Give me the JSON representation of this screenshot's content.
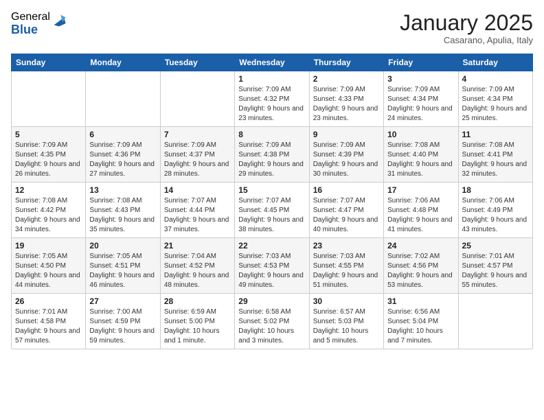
{
  "logo": {
    "general": "General",
    "blue": "Blue"
  },
  "header": {
    "month": "January 2025",
    "location": "Casarano, Apulia, Italy"
  },
  "weekdays": [
    "Sunday",
    "Monday",
    "Tuesday",
    "Wednesday",
    "Thursday",
    "Friday",
    "Saturday"
  ],
  "weeks": [
    [
      {
        "day": "",
        "sunrise": "",
        "sunset": "",
        "daylight": ""
      },
      {
        "day": "",
        "sunrise": "",
        "sunset": "",
        "daylight": ""
      },
      {
        "day": "",
        "sunrise": "",
        "sunset": "",
        "daylight": ""
      },
      {
        "day": "1",
        "sunrise": "Sunrise: 7:09 AM",
        "sunset": "Sunset: 4:32 PM",
        "daylight": "Daylight: 9 hours and 23 minutes."
      },
      {
        "day": "2",
        "sunrise": "Sunrise: 7:09 AM",
        "sunset": "Sunset: 4:33 PM",
        "daylight": "Daylight: 9 hours and 23 minutes."
      },
      {
        "day": "3",
        "sunrise": "Sunrise: 7:09 AM",
        "sunset": "Sunset: 4:34 PM",
        "daylight": "Daylight: 9 hours and 24 minutes."
      },
      {
        "day": "4",
        "sunrise": "Sunrise: 7:09 AM",
        "sunset": "Sunset: 4:34 PM",
        "daylight": "Daylight: 9 hours and 25 minutes."
      }
    ],
    [
      {
        "day": "5",
        "sunrise": "Sunrise: 7:09 AM",
        "sunset": "Sunset: 4:35 PM",
        "daylight": "Daylight: 9 hours and 26 minutes."
      },
      {
        "day": "6",
        "sunrise": "Sunrise: 7:09 AM",
        "sunset": "Sunset: 4:36 PM",
        "daylight": "Daylight: 9 hours and 27 minutes."
      },
      {
        "day": "7",
        "sunrise": "Sunrise: 7:09 AM",
        "sunset": "Sunset: 4:37 PM",
        "daylight": "Daylight: 9 hours and 28 minutes."
      },
      {
        "day": "8",
        "sunrise": "Sunrise: 7:09 AM",
        "sunset": "Sunset: 4:38 PM",
        "daylight": "Daylight: 9 hours and 29 minutes."
      },
      {
        "day": "9",
        "sunrise": "Sunrise: 7:09 AM",
        "sunset": "Sunset: 4:39 PM",
        "daylight": "Daylight: 9 hours and 30 minutes."
      },
      {
        "day": "10",
        "sunrise": "Sunrise: 7:08 AM",
        "sunset": "Sunset: 4:40 PM",
        "daylight": "Daylight: 9 hours and 31 minutes."
      },
      {
        "day": "11",
        "sunrise": "Sunrise: 7:08 AM",
        "sunset": "Sunset: 4:41 PM",
        "daylight": "Daylight: 9 hours and 32 minutes."
      }
    ],
    [
      {
        "day": "12",
        "sunrise": "Sunrise: 7:08 AM",
        "sunset": "Sunset: 4:42 PM",
        "daylight": "Daylight: 9 hours and 34 minutes."
      },
      {
        "day": "13",
        "sunrise": "Sunrise: 7:08 AM",
        "sunset": "Sunset: 4:43 PM",
        "daylight": "Daylight: 9 hours and 35 minutes."
      },
      {
        "day": "14",
        "sunrise": "Sunrise: 7:07 AM",
        "sunset": "Sunset: 4:44 PM",
        "daylight": "Daylight: 9 hours and 37 minutes."
      },
      {
        "day": "15",
        "sunrise": "Sunrise: 7:07 AM",
        "sunset": "Sunset: 4:45 PM",
        "daylight": "Daylight: 9 hours and 38 minutes."
      },
      {
        "day": "16",
        "sunrise": "Sunrise: 7:07 AM",
        "sunset": "Sunset: 4:47 PM",
        "daylight": "Daylight: 9 hours and 40 minutes."
      },
      {
        "day": "17",
        "sunrise": "Sunrise: 7:06 AM",
        "sunset": "Sunset: 4:48 PM",
        "daylight": "Daylight: 9 hours and 41 minutes."
      },
      {
        "day": "18",
        "sunrise": "Sunrise: 7:06 AM",
        "sunset": "Sunset: 4:49 PM",
        "daylight": "Daylight: 9 hours and 43 minutes."
      }
    ],
    [
      {
        "day": "19",
        "sunrise": "Sunrise: 7:05 AM",
        "sunset": "Sunset: 4:50 PM",
        "daylight": "Daylight: 9 hours and 44 minutes."
      },
      {
        "day": "20",
        "sunrise": "Sunrise: 7:05 AM",
        "sunset": "Sunset: 4:51 PM",
        "daylight": "Daylight: 9 hours and 46 minutes."
      },
      {
        "day": "21",
        "sunrise": "Sunrise: 7:04 AM",
        "sunset": "Sunset: 4:52 PM",
        "daylight": "Daylight: 9 hours and 48 minutes."
      },
      {
        "day": "22",
        "sunrise": "Sunrise: 7:03 AM",
        "sunset": "Sunset: 4:53 PM",
        "daylight": "Daylight: 9 hours and 49 minutes."
      },
      {
        "day": "23",
        "sunrise": "Sunrise: 7:03 AM",
        "sunset": "Sunset: 4:55 PM",
        "daylight": "Daylight: 9 hours and 51 minutes."
      },
      {
        "day": "24",
        "sunrise": "Sunrise: 7:02 AM",
        "sunset": "Sunset: 4:56 PM",
        "daylight": "Daylight: 9 hours and 53 minutes."
      },
      {
        "day": "25",
        "sunrise": "Sunrise: 7:01 AM",
        "sunset": "Sunset: 4:57 PM",
        "daylight": "Daylight: 9 hours and 55 minutes."
      }
    ],
    [
      {
        "day": "26",
        "sunrise": "Sunrise: 7:01 AM",
        "sunset": "Sunset: 4:58 PM",
        "daylight": "Daylight: 9 hours and 57 minutes."
      },
      {
        "day": "27",
        "sunrise": "Sunrise: 7:00 AM",
        "sunset": "Sunset: 4:59 PM",
        "daylight": "Daylight: 9 hours and 59 minutes."
      },
      {
        "day": "28",
        "sunrise": "Sunrise: 6:59 AM",
        "sunset": "Sunset: 5:00 PM",
        "daylight": "Daylight: 10 hours and 1 minute."
      },
      {
        "day": "29",
        "sunrise": "Sunrise: 6:58 AM",
        "sunset": "Sunset: 5:02 PM",
        "daylight": "Daylight: 10 hours and 3 minutes."
      },
      {
        "day": "30",
        "sunrise": "Sunrise: 6:57 AM",
        "sunset": "Sunset: 5:03 PM",
        "daylight": "Daylight: 10 hours and 5 minutes."
      },
      {
        "day": "31",
        "sunrise": "Sunrise: 6:56 AM",
        "sunset": "Sunset: 5:04 PM",
        "daylight": "Daylight: 10 hours and 7 minutes."
      },
      {
        "day": "",
        "sunrise": "",
        "sunset": "",
        "daylight": ""
      }
    ]
  ]
}
